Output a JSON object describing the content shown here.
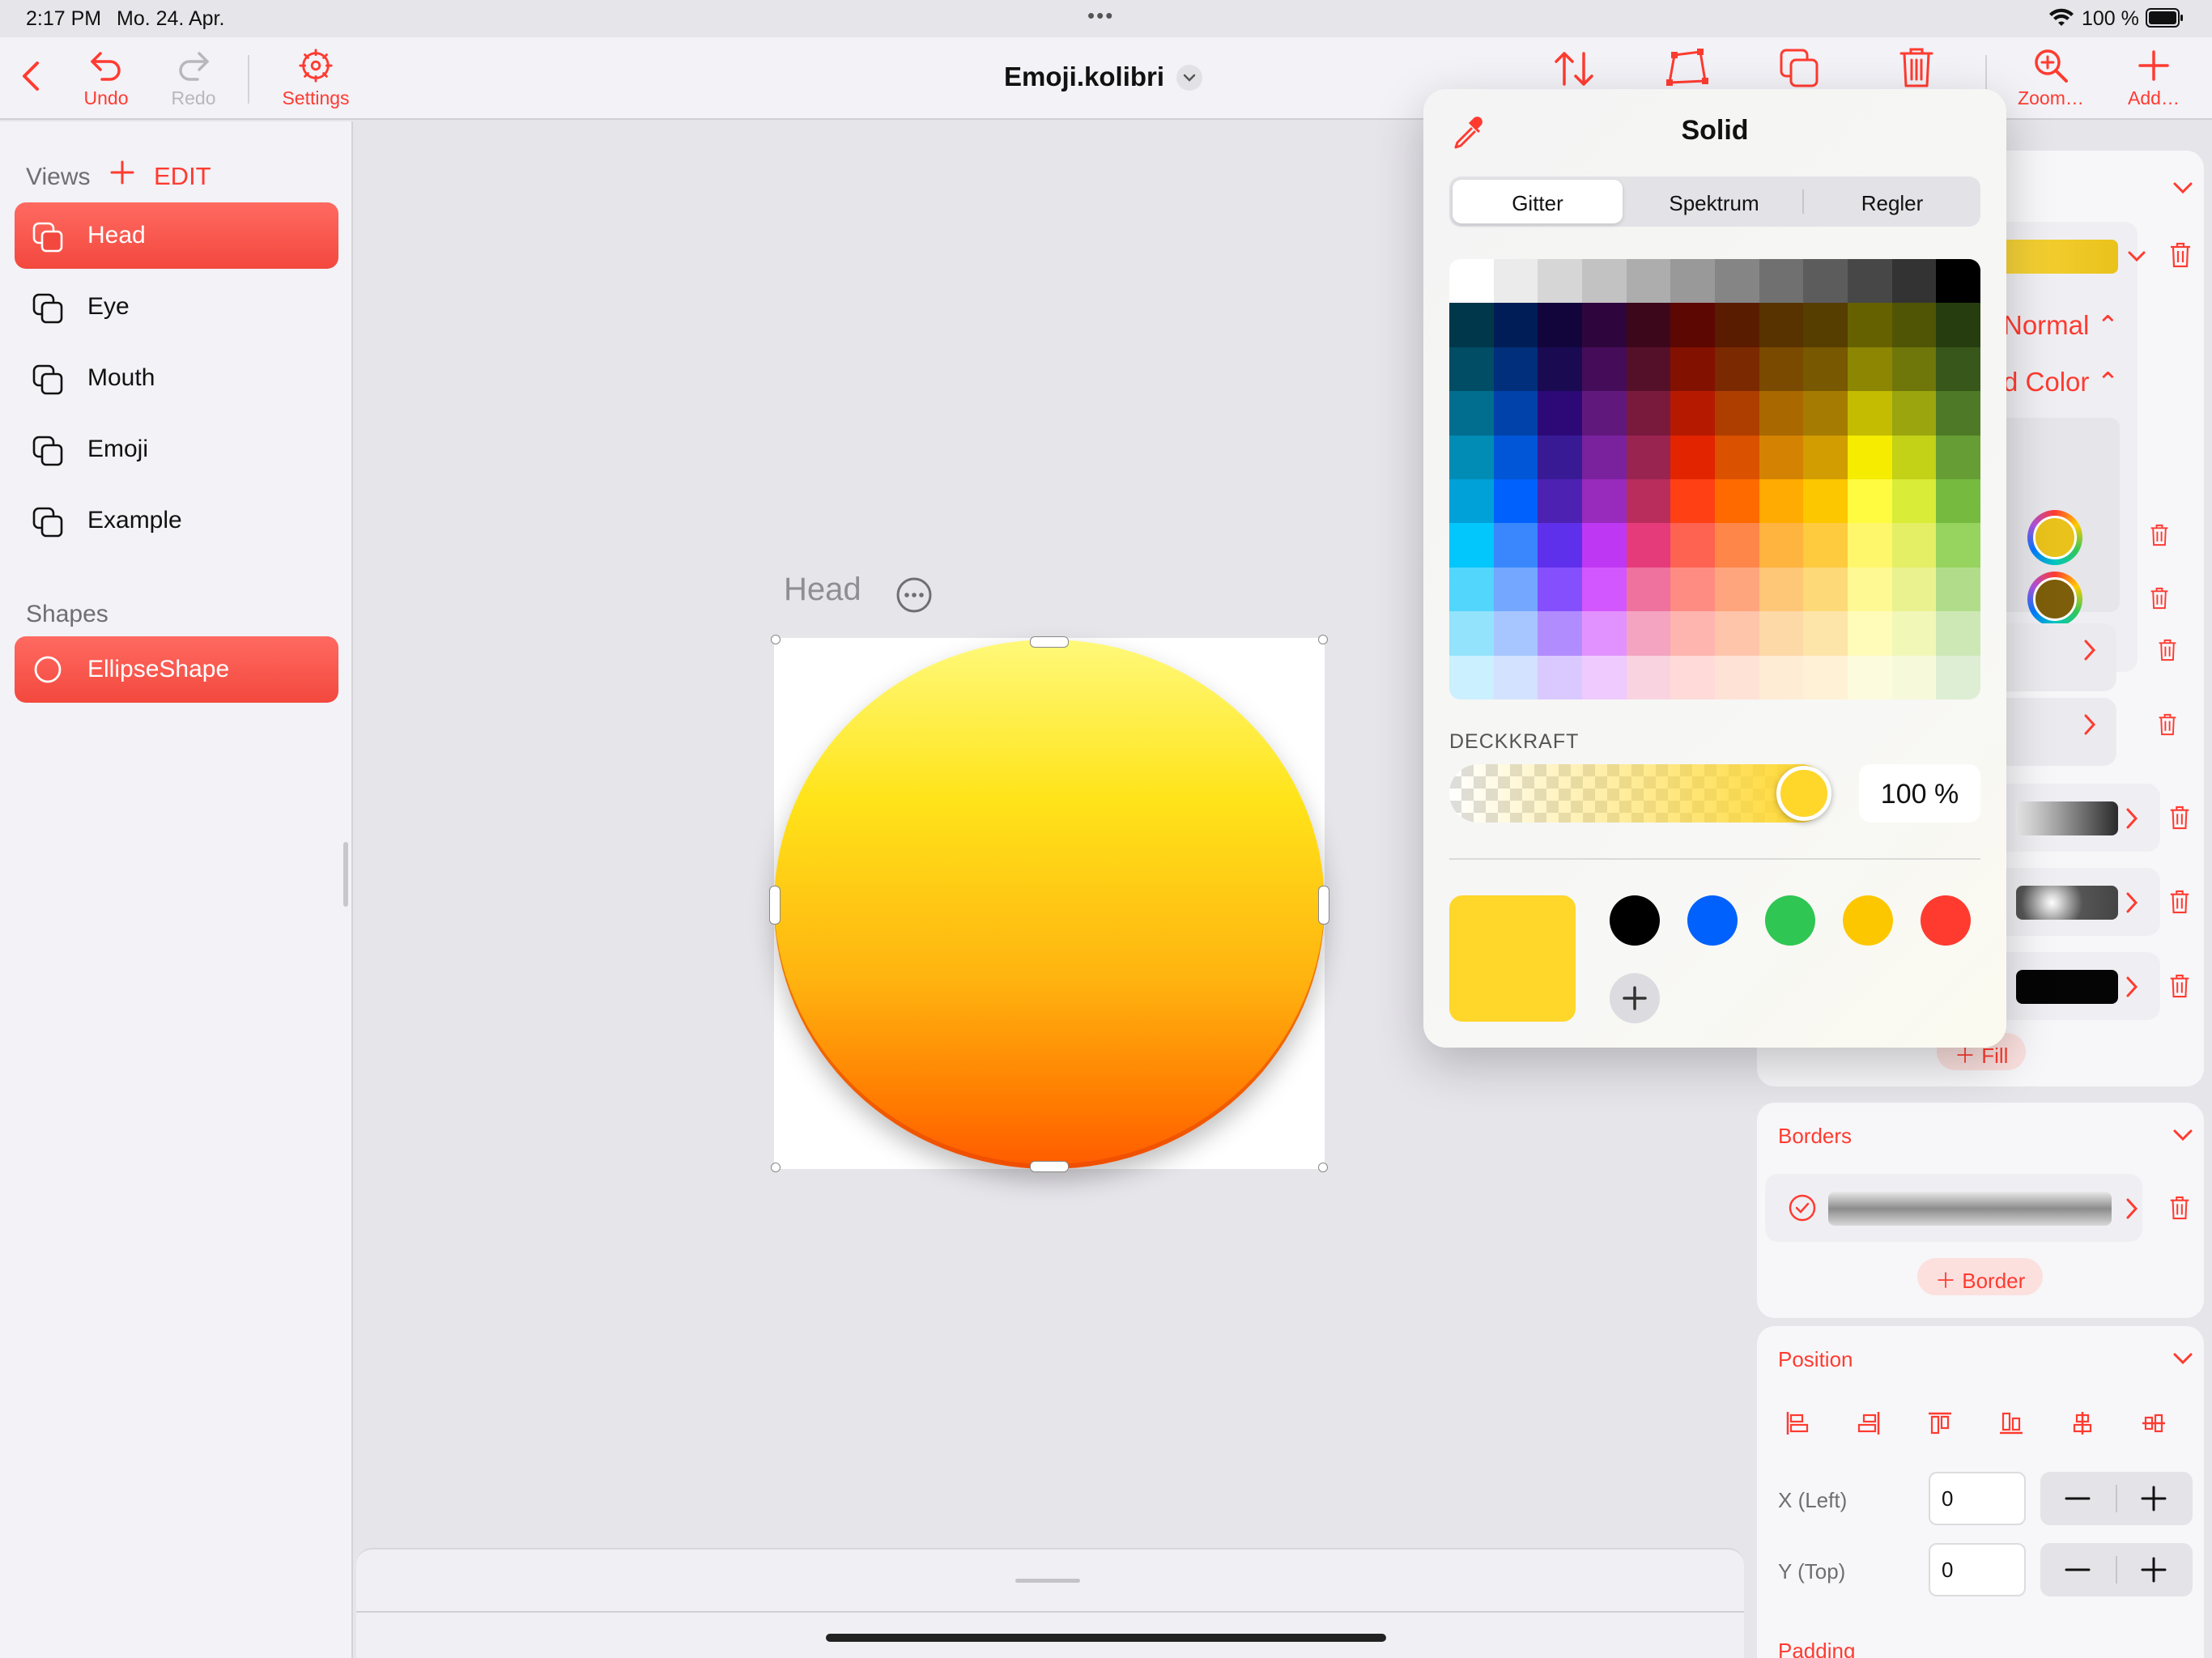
{
  "status_bar": {
    "time": "2:17 PM",
    "date": "Mo. 24. Apr.",
    "dots": "•••",
    "battery": "100 %"
  },
  "toolbar": {
    "undo_label": "Undo",
    "redo_label": "Redo",
    "settings_label": "Settings",
    "document_title": "Emoji.kolibri",
    "zoom_label": "Zoom…",
    "add_label": "Add…"
  },
  "sidebar": {
    "views_header": "Views",
    "edit_label": "EDIT",
    "views": [
      {
        "label": "Head",
        "selected": true
      },
      {
        "label": "Eye",
        "selected": false
      },
      {
        "label": "Mouth",
        "selected": false
      },
      {
        "label": "Emoji",
        "selected": false
      },
      {
        "label": "Example",
        "selected": false
      }
    ],
    "shapes_header": "Shapes",
    "shapes": [
      {
        "label": "EllipseShape",
        "selected": true
      }
    ]
  },
  "canvas": {
    "view_label": "Head"
  },
  "inspector": {
    "blend_mode": "Normal",
    "fill_type_partial": "d Color",
    "fill_button": "Fill",
    "borders_title": "Borders",
    "border_button": "Border",
    "position_title": "Position",
    "x_label": "X (Left)",
    "x_value": "0",
    "y_label": "Y (Top)",
    "y_value": "0",
    "padding_title": "Padding",
    "stop_colors": [
      "#e9c21b",
      "#7d5e0a"
    ]
  },
  "color_picker": {
    "title": "Solid",
    "tabs": [
      {
        "label": "Gitter",
        "active": true
      },
      {
        "label": "Spektrum",
        "active": false
      },
      {
        "label": "Regler",
        "active": false
      }
    ],
    "grid_rows": [
      [
        "#ffffff",
        "#ebebeb",
        "#d6d6d6",
        "#c2c2c2",
        "#adadad",
        "#999999",
        "#858585",
        "#707070",
        "#5c5c5c",
        "#474747",
        "#333333",
        "#000000"
      ],
      [
        "#00374a",
        "#011d57",
        "#11053b",
        "#2e063d",
        "#3c071b",
        "#5c0701",
        "#5a1c00",
        "#583300",
        "#563d00",
        "#666100",
        "#4f5504",
        "#263e0f"
      ],
      [
        "#004d65",
        "#012f7b",
        "#1a0a52",
        "#450d59",
        "#551029",
        "#831100",
        "#7b2900",
        "#7a4a00",
        "#785800",
        "#8c8602",
        "#6f760a",
        "#38571a"
      ],
      [
        "#016e8f",
        "#0042a9",
        "#2c0977",
        "#61187c",
        "#791a3d",
        "#b51a00",
        "#ad3e00",
        "#a96800",
        "#a67b01",
        "#c4bc00",
        "#9ba50e",
        "#4e7a27"
      ],
      [
        "#008cb4",
        "#0056d6",
        "#371a94",
        "#7a219e",
        "#99244f",
        "#e22400",
        "#da5100",
        "#d38301",
        "#d19d01",
        "#f5ec00",
        "#c3d117",
        "#669d34"
      ],
      [
        "#00a1d8",
        "#0061fd",
        "#4d22b2",
        "#982abc",
        "#b92d5d",
        "#ff4015",
        "#ff6a00",
        "#ffab01",
        "#fdc700",
        "#fefb41",
        "#d9ec37",
        "#76bb40"
      ],
      [
        "#01c7fc",
        "#3a87fd",
        "#5e30eb",
        "#be38f3",
        "#e63b7a",
        "#fe6250",
        "#fe8648",
        "#feb43f",
        "#fecb3e",
        "#fff76b",
        "#e4ef65",
        "#96d35f"
      ],
      [
        "#52d6fc",
        "#74a7ff",
        "#864ffd",
        "#d357fe",
        "#ee719e",
        "#ff8c82",
        "#fea57d",
        "#fec777",
        "#fed977",
        "#fff994",
        "#eaf28f",
        "#b1dd8b"
      ],
      [
        "#93e3fc",
        "#a7c6ff",
        "#b18cfe",
        "#e292fe",
        "#f4a4c0",
        "#ffb5af",
        "#ffc5ab",
        "#fed9a8",
        "#fde4a8",
        "#fffbb9",
        "#f1f7b7",
        "#cde8b5"
      ],
      [
        "#cbf0ff",
        "#d3e2ff",
        "#d9c9fe",
        "#efcaff",
        "#f9d3e0",
        "#ffdad8",
        "#ffe2d6",
        "#feecd4",
        "#fef1d5",
        "#fdfbdd",
        "#f6fadb",
        "#deeed4"
      ]
    ],
    "opacity_label": "DECKKRAFT",
    "opacity_value": "100 %",
    "opacity_percent": 100,
    "current_color": "#ffd62a",
    "favorites": [
      "#000000",
      "#0061fd",
      "#2fc653",
      "#fdc700",
      "#ff3b30"
    ]
  }
}
